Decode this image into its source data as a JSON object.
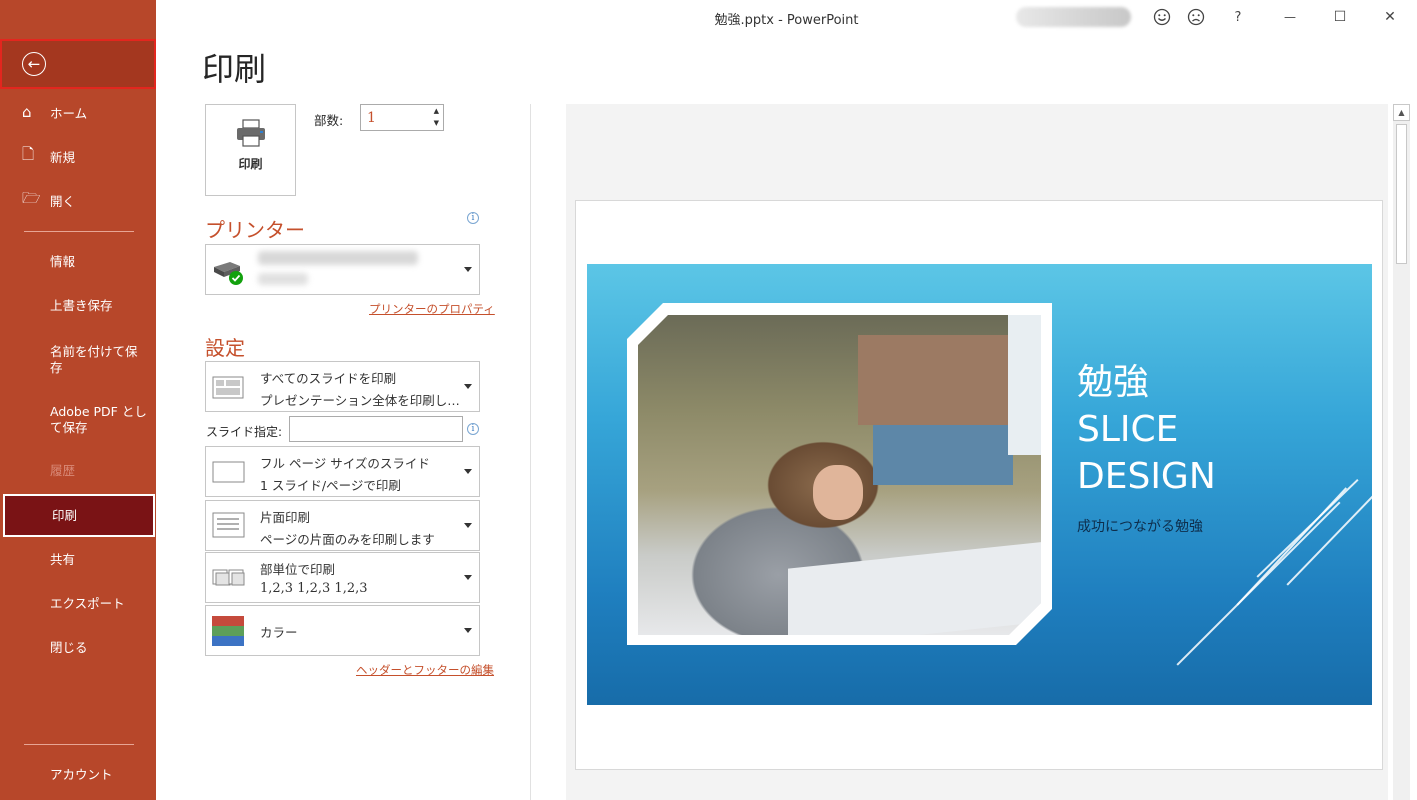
{
  "window": {
    "title": "勉強.pptx  -  PowerPoint",
    "help": "?",
    "minimize": "—",
    "maximize": "☐",
    "close": "✕"
  },
  "sidebar": {
    "back_icon": "←",
    "items": [
      {
        "label": "ホーム",
        "icon": "⌂"
      },
      {
        "label": "新規",
        "icon": "🗋"
      },
      {
        "label": "開く",
        "icon": "🗁"
      },
      {
        "label": "情報"
      },
      {
        "label": "上書き保存"
      },
      {
        "label": "名前を付けて保存"
      },
      {
        "label": "Adobe PDF として保存"
      },
      {
        "label": "履歴"
      },
      {
        "label": "印刷"
      },
      {
        "label": "共有"
      },
      {
        "label": "エクスポート"
      },
      {
        "label": "閉じる"
      },
      {
        "label": "アカウント"
      }
    ]
  },
  "page_title": "印刷",
  "print_button": {
    "label": "印刷"
  },
  "copies": {
    "label": "部数:",
    "value": "1"
  },
  "printer": {
    "heading": "プリンター",
    "properties_link": "プリンターのプロパティ"
  },
  "settings": {
    "heading": "設定",
    "slides_dropdown": {
      "line1": "すべてのスライドを印刷",
      "line2": "プレゼンテーション全体を印刷し…"
    },
    "slide_spec_label": "スライド指定:",
    "layout_dropdown": {
      "line1": "フル ページ サイズのスライド",
      "line2": "1 スライド/ページで印刷"
    },
    "sides_dropdown": {
      "line1": "片面印刷",
      "line2": "ページの片面のみを印刷します"
    },
    "collate_dropdown": {
      "line1": "部単位で印刷",
      "line2": "1,2,3     1,2,3     1,2,3"
    },
    "color_dropdown": {
      "line1": "カラー"
    },
    "header_footer_link": "ヘッダーとフッターの編集"
  },
  "preview": {
    "slide_title_line1": "勉強",
    "slide_title_line2": "SLICE",
    "slide_title_line3": "DESIGN",
    "slide_subtitle": "成功につながる勉強"
  }
}
